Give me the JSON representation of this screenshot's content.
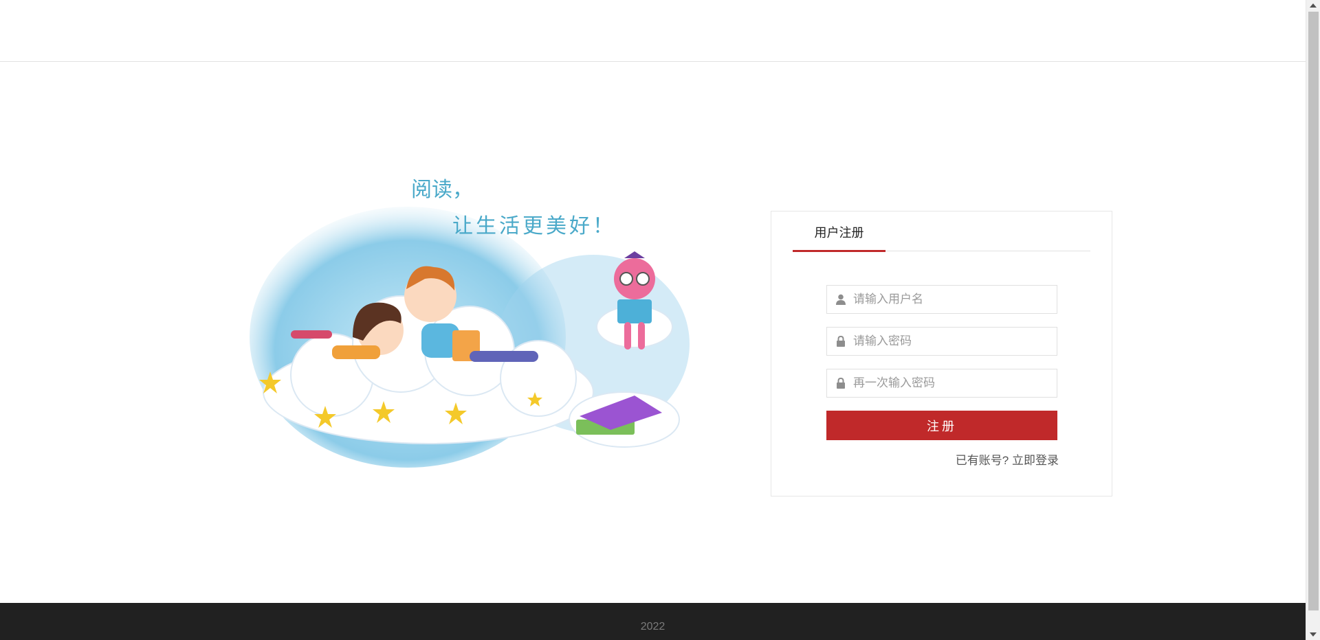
{
  "illustration": {
    "slogan_line1": "阅读，",
    "slogan_line2": "让生活更美好！"
  },
  "panel": {
    "tab_label": "用户注册",
    "username_placeholder": "请输入用户名",
    "password_placeholder": "请输入密码",
    "confirm_placeholder": "再一次输入密码",
    "submit_label": "注册",
    "login_prompt": "已有账号?",
    "login_link": "立即登录"
  },
  "footer": {
    "year": "2022"
  },
  "colors": {
    "accent": "#c0292a",
    "footer_bg": "#212121"
  },
  "icons": {
    "username": "user-icon",
    "password": "lock-icon",
    "confirm": "lock-icon"
  }
}
